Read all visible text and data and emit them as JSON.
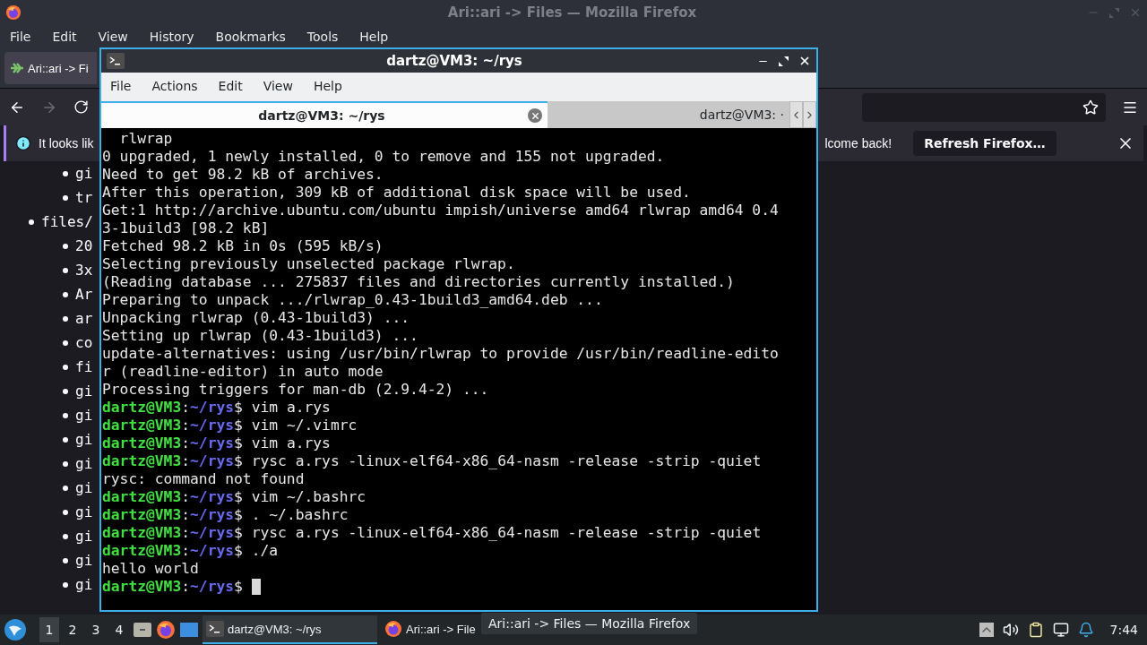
{
  "browser": {
    "title": "Ari::ari -> Files — Mozilla Firefox",
    "menu": [
      "File",
      "Edit",
      "View",
      "History",
      "Bookmarks",
      "Tools",
      "Help"
    ],
    "tab": {
      "title": "Ari::ari -> Fi",
      "selected": true
    },
    "notification": {
      "text_start": "It looks lik",
      "text_end": "lcome back!",
      "button": "Refresh Firefox…"
    },
    "page": {
      "items": [
        {
          "children": [
            {
              "text": "gi"
            },
            {
              "text": "tr"
            }
          ]
        },
        {
          "text": "files/",
          "children": [
            {
              "text": "20"
            },
            {
              "text": "3x"
            },
            {
              "text": "Ar"
            },
            {
              "text": "ar"
            },
            {
              "text": "co"
            },
            {
              "text": "fi"
            },
            {
              "text": "gi"
            },
            {
              "text": "gi"
            },
            {
              "text": "gi"
            },
            {
              "text": "gi"
            },
            {
              "text": "gi"
            },
            {
              "text": "gi"
            },
            {
              "text": "gi"
            },
            {
              "text": "gi"
            },
            {
              "text": "gi"
            }
          ]
        }
      ]
    }
  },
  "terminal": {
    "title": "dartz@VM3: ~/rys",
    "menu": [
      "File",
      "Actions",
      "Edit",
      "View",
      "Help"
    ],
    "tabs": [
      {
        "title": "dartz@VM3: ~/rys",
        "selected": true
      },
      {
        "title": "dartz@VM3: ·",
        "selected": false
      }
    ],
    "lines": [
      {
        "kind": "output",
        "text": "  rlwrap"
      },
      {
        "kind": "output",
        "text": "0 upgraded, 1 newly installed, 0 to remove and 155 not upgraded."
      },
      {
        "kind": "output",
        "text": "Need to get 98.2 kB of archives."
      },
      {
        "kind": "output",
        "text": "After this operation, 309 kB of additional disk space will be used."
      },
      {
        "kind": "output",
        "text": "Get:1 http://archive.ubuntu.com/ubuntu impish/universe amd64 rlwrap amd64 0.4"
      },
      {
        "kind": "output",
        "text": "3-1build3 [98.2 kB]"
      },
      {
        "kind": "output",
        "text": "Fetched 98.2 kB in 0s (595 kB/s)"
      },
      {
        "kind": "output",
        "text": "Selecting previously unselected package rlwrap."
      },
      {
        "kind": "output",
        "text": "(Reading database ... 275837 files and directories currently installed.)"
      },
      {
        "kind": "output",
        "text": "Preparing to unpack .../rlwrap_0.43-1build3_amd64.deb ..."
      },
      {
        "kind": "output",
        "text": "Unpacking rlwrap (0.43-1build3) ..."
      },
      {
        "kind": "output",
        "text": "Setting up rlwrap (0.43-1build3) ..."
      },
      {
        "kind": "output",
        "text": "update-alternatives: using /usr/bin/rlwrap to provide /usr/bin/readline-edito"
      },
      {
        "kind": "output",
        "text": "r (readline-editor) in auto mode"
      },
      {
        "kind": "output",
        "text": "Processing triggers for man-db (2.9.4-2) ..."
      },
      {
        "kind": "prompt",
        "user": "dartz@VM3",
        "colon": ":",
        "path": "~/rys",
        "symbol": "$",
        "command": "vim a.rys"
      },
      {
        "kind": "prompt",
        "user": "dartz@VM3",
        "colon": ":",
        "path": "~/rys",
        "symbol": "$",
        "command": "vim ~/.vimrc"
      },
      {
        "kind": "prompt",
        "user": "dartz@VM3",
        "colon": ":",
        "path": "~/rys",
        "symbol": "$",
        "command": "vim a.rys"
      },
      {
        "kind": "prompt",
        "user": "dartz@VM3",
        "colon": ":",
        "path": "~/rys",
        "symbol": "$",
        "command": "rysc a.rys -linux-elf64-x86_64-nasm -release -strip -quiet"
      },
      {
        "kind": "output",
        "text": "rysc: command not found"
      },
      {
        "kind": "prompt",
        "user": "dartz@VM3",
        "colon": ":",
        "path": "~/rys",
        "symbol": "$",
        "command": "vim ~/.bashrc"
      },
      {
        "kind": "prompt",
        "user": "dartz@VM3",
        "colon": ":",
        "path": "~/rys",
        "symbol": "$",
        "command": ". ~/.bashrc"
      },
      {
        "kind": "prompt",
        "user": "dartz@VM3",
        "colon": ":",
        "path": "~/rys",
        "symbol": "$",
        "command": "rysc a.rys -linux-elf64-x86_64-nasm -release -strip -quiet"
      },
      {
        "kind": "prompt",
        "user": "dartz@VM3",
        "colon": ":",
        "path": "~/rys",
        "symbol": "$",
        "command": "./a"
      },
      {
        "kind": "output",
        "text": "hello world"
      },
      {
        "kind": "cursor",
        "user": "dartz@VM3",
        "colon": ":",
        "path": "~/rys",
        "symbol": "$"
      }
    ]
  },
  "taskbar": {
    "workspaces": [
      {
        "label": "1",
        "selected": true
      },
      {
        "label": "2",
        "selected": false
      },
      {
        "label": "3",
        "selected": false
      },
      {
        "label": "4",
        "selected": false
      }
    ],
    "tasks": [
      {
        "kind": "terminal",
        "title": "dartz@VM3: ~/rys",
        "selected": true
      },
      {
        "kind": "browser",
        "title": "Ari::ari -> File",
        "selected": false
      }
    ],
    "tooltip": "Ari::ari -> Files — Mozilla Firefox",
    "clock": "7:44"
  }
}
